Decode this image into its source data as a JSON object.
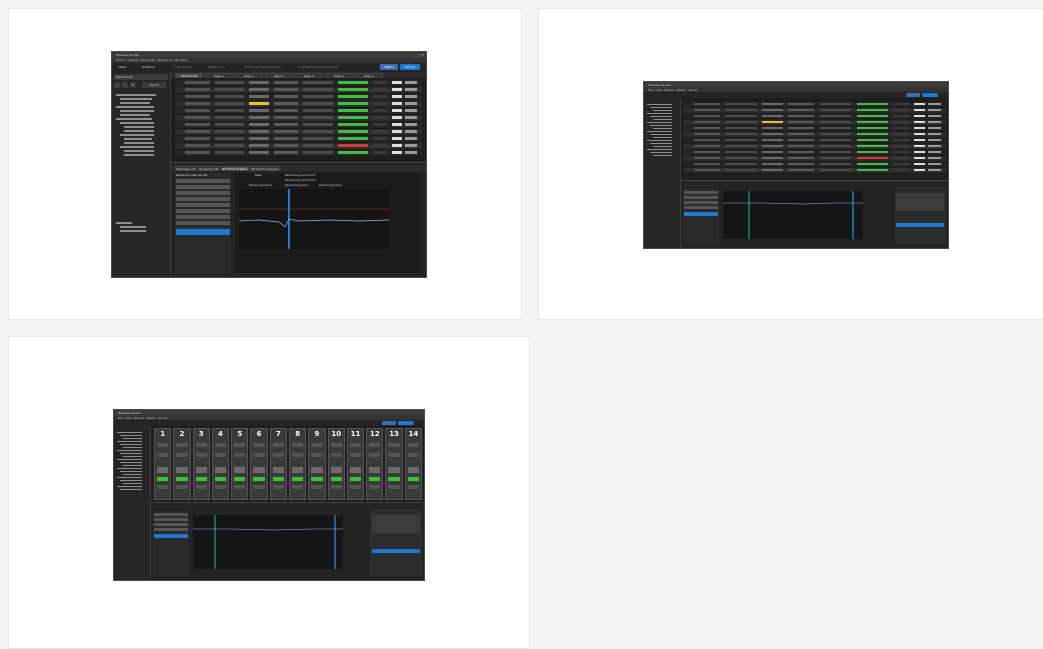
{
  "colors": {
    "page_bg": "#f3f3f3",
    "card_bg": "#ffffff",
    "app_bg": "#1e1e1e",
    "accent_blue": "#1e7ad1",
    "meter_green": "#3fbf3f",
    "alert_red": "#d63a3a",
    "warn_yellow": "#e8c02a"
  },
  "screens": [
    {
      "title": "Wireless Studio",
      "menu": [
        "File(F)",
        "View(V)",
        "Device(D)",
        "Option(O)",
        "About(A)"
      ],
      "toolbar": {
        "items": [
          "Label",
          "ID Name",
          "Mute setting",
          "RF/Mic Gain",
          "AF/RF, Mic and Phantom",
          "Select/RF/Mic and Phantom"
        ],
        "offline": "Offline",
        "online": "Online"
      },
      "sidebar": {
        "header": "Device List",
        "search_label": "Search"
      },
      "tabs": [
        "All Devices",
        "Page 1",
        "Page 2",
        "Page 3",
        "Page 4",
        "Page 5",
        "Page 6"
      ],
      "right_controls": [
        "All muting",
        "All unmuting",
        "Close all Pack mute"
      ],
      "lower_tabs": [
        "Message List",
        "Property List",
        "RF Chart Graphic",
        "RF Chart Analyzer"
      ],
      "lower_panel": {
        "list_header": "Receiver channel list",
        "chart_title": "Main",
        "legend": [
          "Receiving level",
          "Receiving level",
          "Receiving level"
        ],
        "threshold": [
          "Receiving level limit",
          "Receiving level limit"
        ]
      }
    },
    {
      "title": "Wireless Studio",
      "menu": [
        "File",
        "View",
        "Device",
        "Option",
        "About"
      ]
    },
    {
      "title": "Wireless Studio",
      "menu": [
        "File",
        "View",
        "Device",
        "Option",
        "About"
      ],
      "channels": [
        "1",
        "2",
        "3",
        "4",
        "5",
        "6",
        "7",
        "8",
        "9",
        "10",
        "11",
        "12",
        "13",
        "14"
      ]
    }
  ]
}
